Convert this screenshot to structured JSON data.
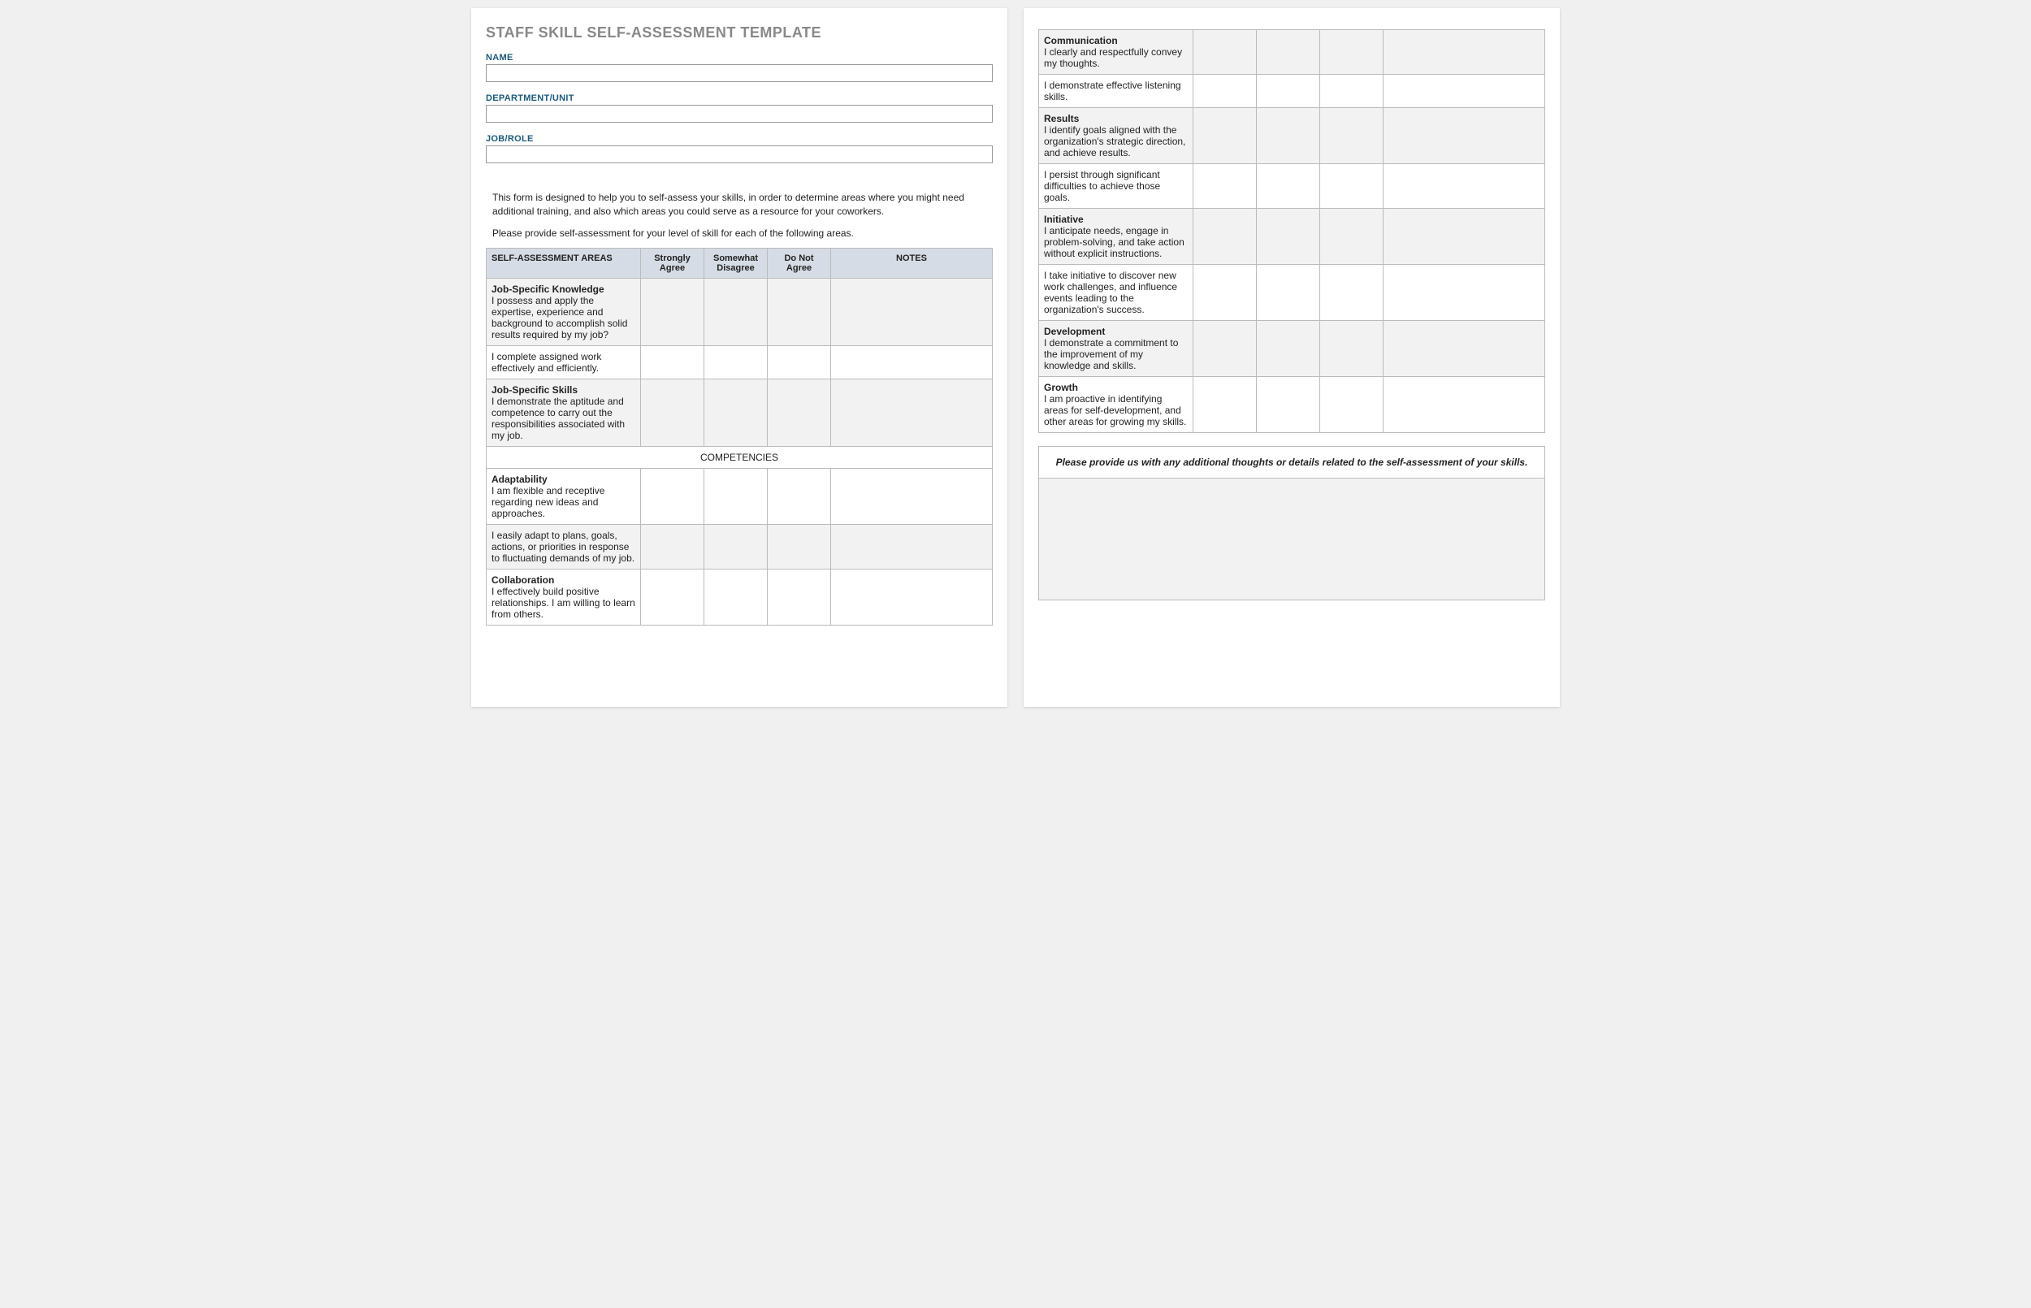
{
  "title": "STAFF SKILL SELF-ASSESSMENT TEMPLATE",
  "fields": {
    "name_label": "NAME",
    "dept_label": "DEPARTMENT/UNIT",
    "role_label": "JOB/ROLE"
  },
  "intro1": "This form is designed to help you to self-assess your skills, in order to determine areas where you might need additional training, and also which areas you could serve as a resource for your coworkers.",
  "intro2": "Please provide self-assessment for your level of skill for each of the following areas.",
  "headers": {
    "areas": "SELF-ASSESSMENT AREAS",
    "sa": "Strongly Agree",
    "swd": "Somewhat Disagree",
    "dna": "Do Not Agree",
    "notes": "NOTES"
  },
  "section_comp": "COMPETENCIES",
  "rows1": [
    {
      "title": "Job-Specific Knowledge",
      "desc": "I possess and apply the expertise, experience and background to accomplish solid results required by my job?",
      "alt": false
    },
    {
      "title": "",
      "desc": "I complete assigned work effectively and efficiently.",
      "alt": true
    },
    {
      "title": "Job-Specific Skills",
      "desc": "I demonstrate the aptitude and competence to carry out the responsibilities associated with my job.",
      "alt": false
    }
  ],
  "rows1b": [
    {
      "title": "Adaptability",
      "desc": "I am flexible and receptive regarding new ideas and approaches.",
      "alt": true
    },
    {
      "title": "",
      "desc": "I easily adapt to plans, goals, actions, or priorities in response to fluctuating demands of my job.",
      "alt": false
    },
    {
      "title": "Collaboration",
      "desc": "I effectively build positive relationships. I am willing to learn from others.",
      "alt": true
    }
  ],
  "rows2": [
    {
      "title": "Communication",
      "desc": "I clearly and respectfully convey my thoughts.",
      "alt": false
    },
    {
      "title": "",
      "desc": "I demonstrate effective listening skills.",
      "alt": true
    },
    {
      "title": "Results",
      "desc": "I identify goals aligned with the organization's strategic direction, and achieve results.",
      "alt": false
    },
    {
      "title": "",
      "desc": "I persist through significant difficulties to achieve those goals.",
      "alt": true
    },
    {
      "title": "Initiative",
      "desc": "I anticipate needs, engage in problem-solving, and take action without explicit instructions.",
      "alt": false
    },
    {
      "title": "",
      "desc": "I take initiative to discover new work challenges, and influence events leading to the organization's success.",
      "alt": true
    },
    {
      "title": "Development",
      "desc": "I demonstrate a commitment to the improvement of my knowledge and skills.",
      "alt": false
    },
    {
      "title": "Growth",
      "desc": "I am proactive in identifying areas for self-development, and other areas for growing my skills.",
      "alt": true
    }
  ],
  "feedback_prompt": "Please provide us with any additional thoughts or details related to the self-assessment of your skills."
}
